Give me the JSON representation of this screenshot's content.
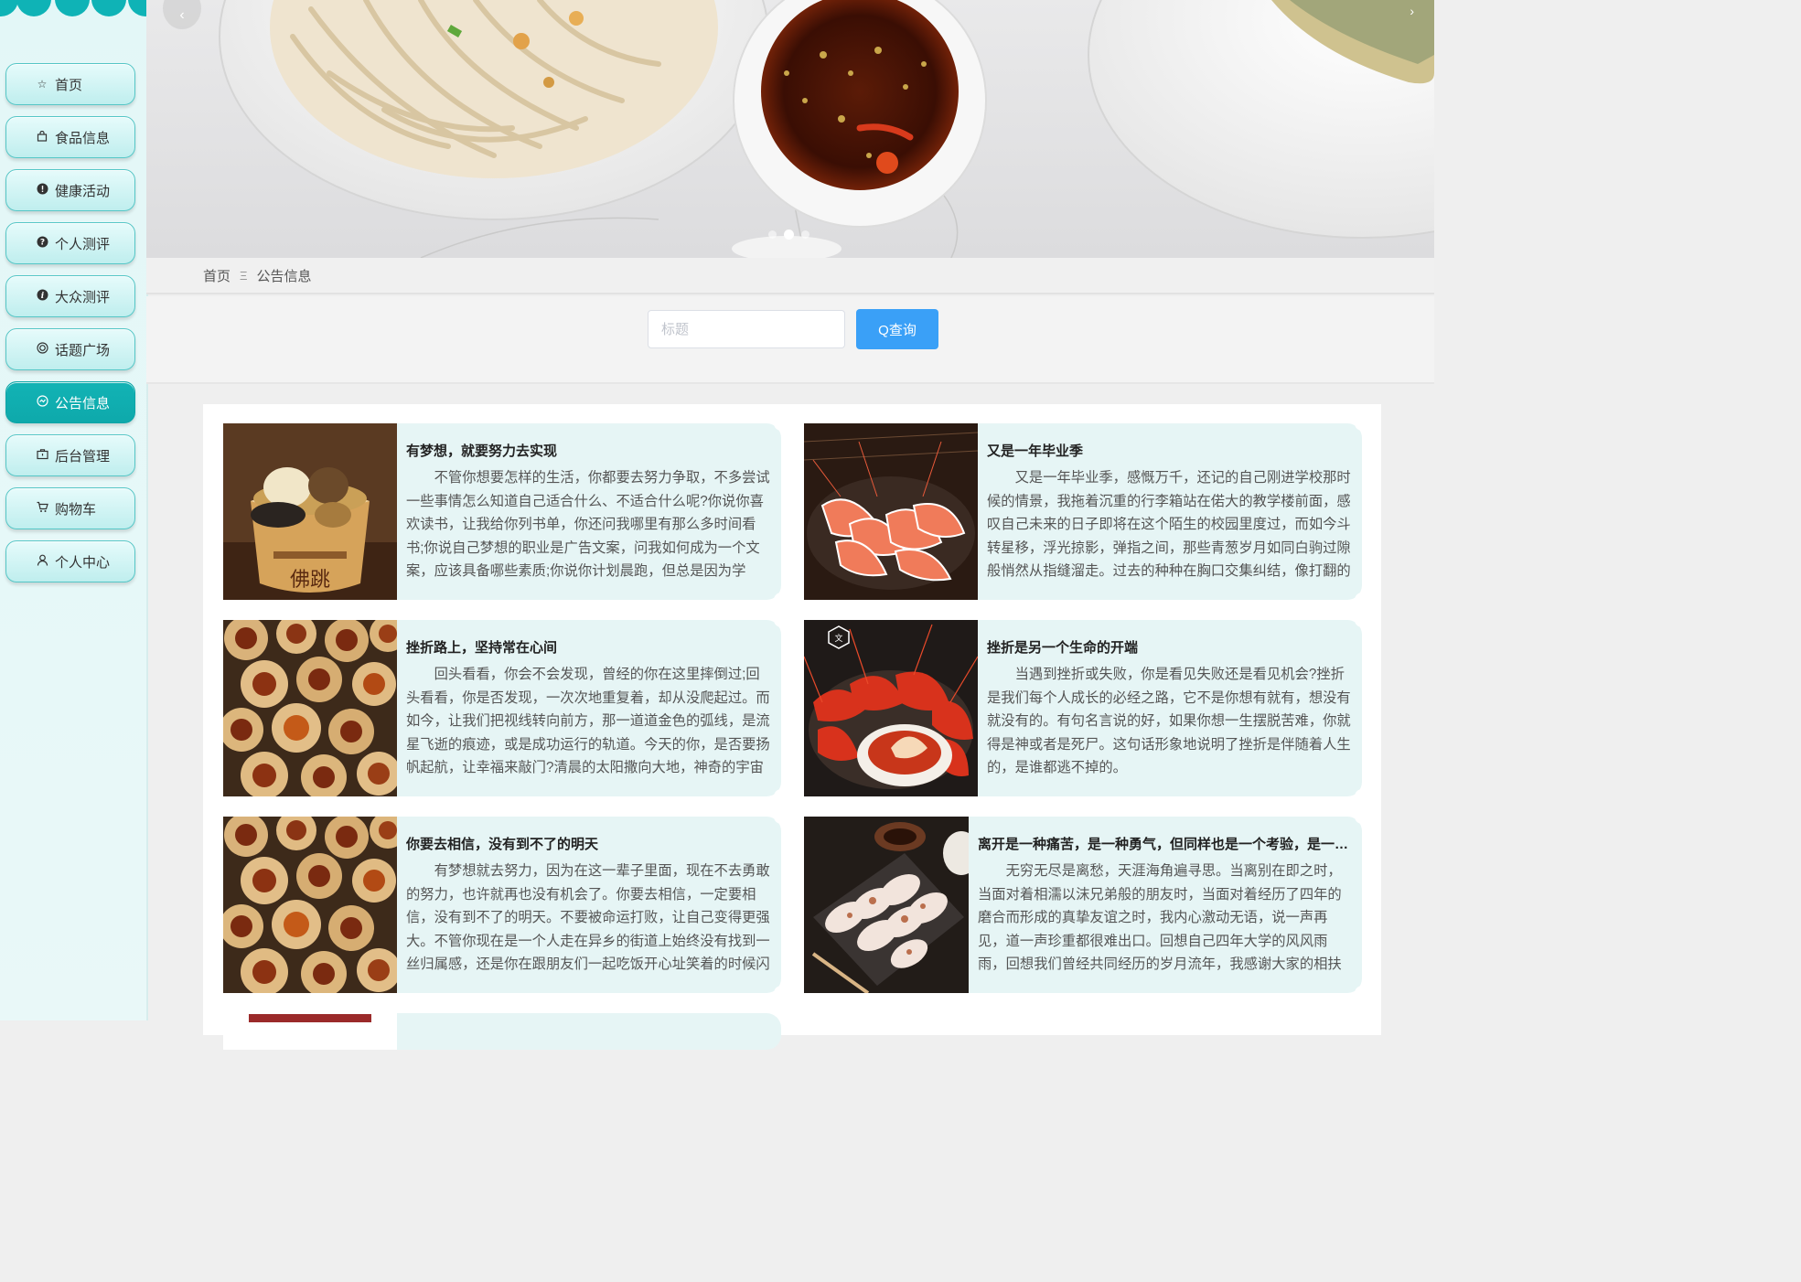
{
  "nav": {
    "items": [
      {
        "label": "首页",
        "icon": "star-icon"
      },
      {
        "label": "食品信息",
        "icon": "bag-icon"
      },
      {
        "label": "健康活动",
        "icon": "exclamation-circle-icon"
      },
      {
        "label": "个人测评",
        "icon": "question-circle-icon"
      },
      {
        "label": "大众测评",
        "icon": "info-circle-icon"
      },
      {
        "label": "话题广场",
        "icon": "ring-icon"
      },
      {
        "label": "公告信息",
        "icon": "chart-circle-icon",
        "active": true
      },
      {
        "label": "后台管理",
        "icon": "briefcase-icon"
      },
      {
        "label": "购物车",
        "icon": "cart-icon"
      },
      {
        "label": "个人中心",
        "icon": "user-icon"
      }
    ]
  },
  "breadcrumb": {
    "home": "首页",
    "separator": "Ξ",
    "current": "公告信息"
  },
  "search": {
    "placeholder": "标题",
    "button_label": "Q查询"
  },
  "colors": {
    "accent": "#0fb3b6",
    "button": "#3aa0f7",
    "card_bg": "#e6f5f5"
  },
  "notices": [
    {
      "title": "有梦想，就要努力去实现",
      "body": "不管你想要怎样的生活，你都要去努力争取，不多尝试一些事情怎么知道自己适合什么、不适合什么呢?你说你喜欢读书，让我给你列书单，你还问我哪里有那么多时间看书;你说自己梦想的职业是广告文案，问我如何成为一个文案，应该具备哪些素质;你说你计划晨跑，但总是因为学习、工作辛苦",
      "image": "abalone-soup-pot"
    },
    {
      "title": "又是一年毕业季",
      "body": "又是一年毕业季，感慨万千，还记的自己刚进学校那时候的情景，我拖着沉重的行李箱站在偌大的教学楼前面，感叹自己未来的日子即将在这个陌生的校园里度过，而如今斗转星移，浮光掠影，弹指之间，那些青葱岁月如同白驹过隙般悄然从指缝溜走。过去的种种在胸口交集纠结，像打翻的",
      "image": "shrimp-plate"
    },
    {
      "title": "挫折路上，坚持常在心间",
      "body": "回头看看，你会不会发现，曾经的你在这里摔倒过;回头看看，你是否发现，一次次地重复着，却从没爬起过。而如今，让我们把视线转向前方，那一道道金色的弧线，是流星飞逝的痕迹，或是成功运行的轨道。今天的你，是否要扬帆起航，让幸福来敲门?清晨的太阳撒向大地，神奇的宇宙赋予",
      "image": "mushroom-caps"
    },
    {
      "title": "挫折是另一个生命的开端",
      "body": "当遇到挫折或失败，你是看见失败还是看见机会?挫折是我们每个人成长的必经之路，它不是你想有就有，想没有就没有的。有句名言说的好，如果你想一生摆脱苦难，你就得是神或者是死尸。这句话形象地说明了挫折是伴随着人生的，是谁都逃不掉的。",
      "image": "crayfish-bowl"
    },
    {
      "title": "你要去相信，没有到不了的明天",
      "body": "有梦想就去努力，因为在这一辈子里面，现在不去勇敢的努力，也许就再也没有机会了。你要去相信，一定要相信，没有到不了的明天。不要被命运打败，让自己变得更强大。不管你现在是一个人走在异乡的街道上始终没有找到一丝归属感，还是你在跟朋友们一起吃饭开心址笑着的时候闪",
      "image": "mushroom-caps"
    },
    {
      "title": "离开是一种痛苦，是一种勇气，但同样也是一个考验，是一个机会",
      "body": "无穷无尽是离愁，天涯海角遍寻思。当离别在即之时，当面对着相濡以沫兄弟般的朋友时，当面对着经历了四年的磨合而形成的真挚友谊之时，我内心激动无语，说一声再见，道一声珍重都很难出口。回想自己四年大学的风风雨雨，回想我们曾经共同经历的岁月流年，我感谢大家的相扶相依，感谢朋友",
      "image": "rice-rolls"
    }
  ]
}
